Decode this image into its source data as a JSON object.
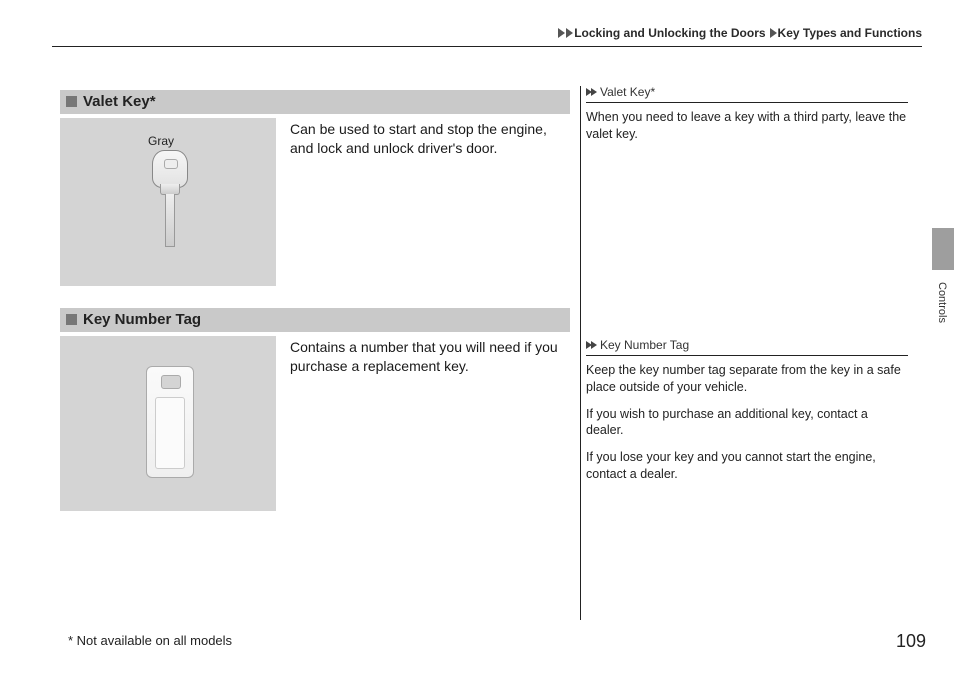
{
  "header": {
    "crumb1": "Locking and Unlocking the Doors",
    "crumb2": "Key Types and Functions"
  },
  "side": {
    "label": "Controls"
  },
  "sections": [
    {
      "title": "Valet Key*",
      "image_label": "Gray",
      "body": "Can be used to start and stop the engine, and lock and unlock driver's door."
    },
    {
      "title": "Key Number Tag",
      "body": "Contains a number that you will need if you purchase a replacement key."
    }
  ],
  "notes": [
    {
      "title": "Valet Key*",
      "body": "When you need to leave a key with a third party, leave the valet key."
    },
    {
      "title": "Key Number Tag",
      "body1": "Keep the key number tag separate from the key in a safe place outside of your vehicle.",
      "body2": "If you wish to purchase an additional key, contact a dealer.",
      "body3": "If you lose your key and you cannot start the engine, contact a dealer."
    }
  ],
  "footer": {
    "note": "* Not available on all models",
    "page": "109"
  }
}
